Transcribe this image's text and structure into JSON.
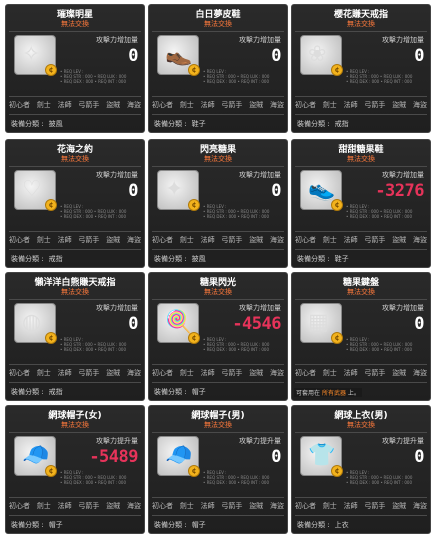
{
  "screen": {
    "background": "#ffffff"
  },
  "common": {
    "untradeable": "無法交換",
    "attack_increase": "攻擊力增加量",
    "attack_raise": "攻擊力提升量",
    "category_label": "裝備分類 :",
    "jobs": [
      "初心者",
      "劍士",
      "法師",
      "弓箭手",
      "盜賊",
      "海盜"
    ],
    "stats": [
      "• REQ LEV :",
      "• REQ STR : 000 • REQ LUK : 000",
      "• REQ DEX : 000 • REQ INT : 000"
    ]
  },
  "cards": [
    {
      "title": "璀璨明星",
      "attack_label": "攻擊力增加量",
      "attack_value": "0",
      "category": "披風",
      "icon": "star-ring-icon",
      "glyph": "✧"
    },
    {
      "title": "白日夢皮鞋",
      "attack_label": "攻擊力增加量",
      "attack_value": "0",
      "category": "鞋子",
      "icon": "shoe-icon",
      "glyph": "👞"
    },
    {
      "title": "櫻花賺天戒指",
      "attack_label": "攻擊力增加量",
      "attack_value": "0",
      "category": "戒指",
      "icon": "ring-icon",
      "glyph": "❀"
    },
    {
      "title": "花海之約",
      "attack_label": "攻擊力增加量",
      "attack_value": "0",
      "category": "戒指",
      "icon": "ring-icon",
      "glyph": "♡"
    },
    {
      "title": "閃亮糖果",
      "attack_label": "攻擊力增加量",
      "attack_value": "0",
      "category": "披風",
      "icon": "sparkle-icon",
      "glyph": "✦"
    },
    {
      "title": "甜甜糖果鞋",
      "attack_label": "攻擊力增加量",
      "attack_value": "-3276",
      "category": "鞋子",
      "icon": "shoe-icon",
      "glyph": "👟"
    },
    {
      "title": "懶洋洋白熊賺天戒指",
      "attack_label": "攻擊力增加量",
      "attack_value": "0",
      "category": "戒指",
      "icon": "bear-ring-icon",
      "glyph": "◍"
    },
    {
      "title": "糖果閃光",
      "attack_label": "攻擊力增加量",
      "attack_value": "-4546",
      "category": "帽子",
      "icon": "candy-icon",
      "glyph": "🍭"
    },
    {
      "title": "糖果鍵盤",
      "attack_label": "攻擊力增加量",
      "attack_value": "0",
      "category": "",
      "icon": "keyboard-icon",
      "glyph": "▦",
      "extra_prefix": "可套用在",
      "extra_highlight": "所有武器",
      "extra_suffix": "上。"
    },
    {
      "title": "網球帽子(女)",
      "attack_label": "攻擊力提升量",
      "attack_value": "-5489",
      "category": "帽子",
      "icon": "cap-icon",
      "glyph": "🧢"
    },
    {
      "title": "網球帽子(男)",
      "attack_label": "攻擊力提升量",
      "attack_value": "0",
      "category": "帽子",
      "icon": "cap-icon",
      "glyph": "🧢"
    },
    {
      "title": "網球上衣(男)",
      "attack_label": "攻擊力提升量",
      "attack_value": "0",
      "category": "上衣",
      "icon": "shirt-icon",
      "glyph": "👕"
    }
  ]
}
